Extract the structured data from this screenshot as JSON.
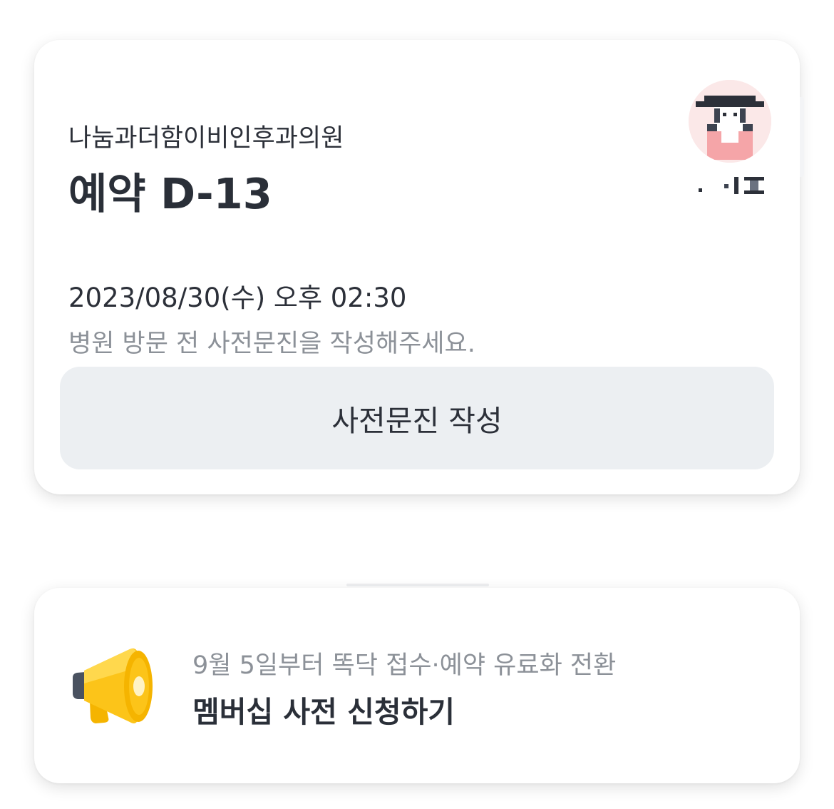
{
  "appointment": {
    "clinic_name": "나눔과더함이비인후과의원",
    "dday_label": "예약 D-13",
    "datetime": "2023/08/30(수) 오후 02:30",
    "notice": "병원 방문 전 사전문진을 작성해주세요.",
    "questionnaire_button": "사전문진 작성",
    "doctor_avatar_icon": "doctor-avatar-icon",
    "doctor_name_icon": "pixelated-doctor-name"
  },
  "membership": {
    "icon": "megaphone-icon",
    "subtitle": "9월 5일부터 똑닥 접수·예약 유료화 전환",
    "title": "멤버십 사전 신청하기"
  },
  "colors": {
    "text_primary": "#2a2f38",
    "text_secondary": "#8c9198",
    "button_bg": "#eceff2",
    "megaphone_yellow": "#fcc419",
    "avatar_bg": "#fbe8e8"
  }
}
